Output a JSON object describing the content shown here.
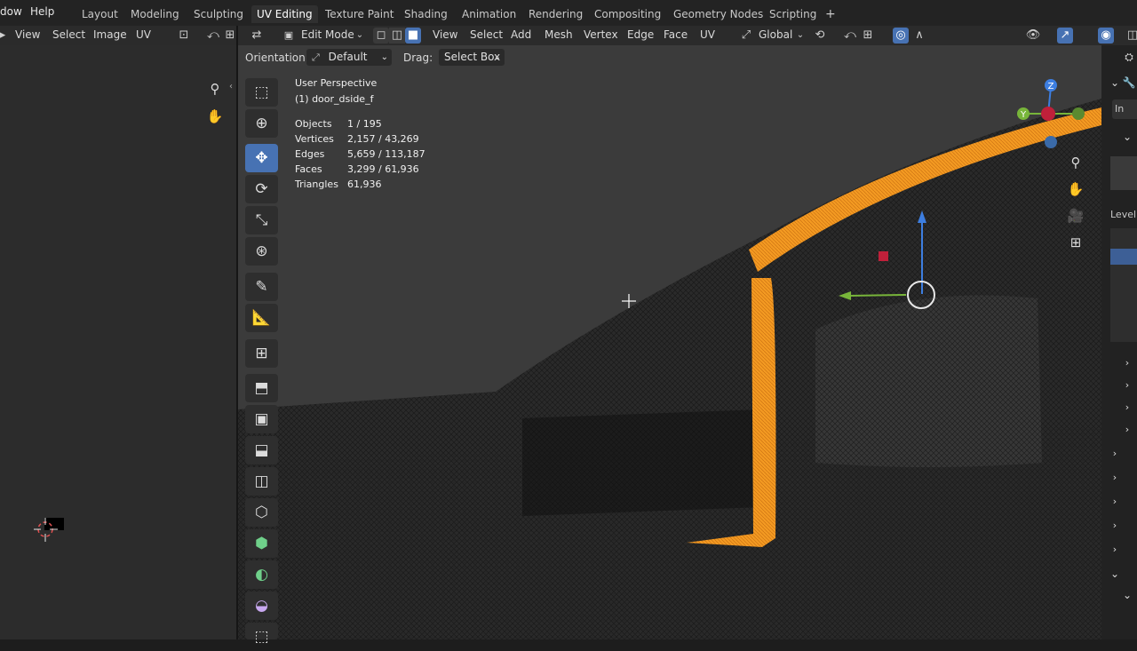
{
  "topbar": {
    "menus": [
      "dow",
      "Help"
    ],
    "workspaces": [
      {
        "label": "Layout"
      },
      {
        "label": "Modeling"
      },
      {
        "label": "Sculpting"
      },
      {
        "label": "UV Editing"
      },
      {
        "label": "Texture Paint"
      },
      {
        "label": "Shading"
      },
      {
        "label": "Animation"
      },
      {
        "label": "Rendering"
      },
      {
        "label": "Compositing"
      },
      {
        "label": "Geometry Nodes"
      },
      {
        "label": "Scripting"
      }
    ],
    "active_workspace": "UV Editing",
    "add_workspace": "+"
  },
  "uv_header": {
    "menus": [
      "View",
      "Select",
      "Image",
      "UV"
    ]
  },
  "viewport_header": {
    "mode": "Edit Mode",
    "menus": [
      "View",
      "Select",
      "Add",
      "Mesh",
      "Vertex",
      "Edge",
      "Face",
      "UV"
    ],
    "transform_orientation": "Global"
  },
  "tool_settings": {
    "orientation_label": "Orientation:",
    "orientation_value": "Default",
    "drag_label": "Drag:",
    "drag_value": "Select Box"
  },
  "overlay": {
    "view_name": "User Perspective",
    "object_name": "(1) door_dside_f",
    "stats": [
      {
        "label": "Objects",
        "value": "1 / 195"
      },
      {
        "label": "Vertices",
        "value": "2,157 / 43,269"
      },
      {
        "label": "Edges",
        "value": "5,659 / 113,187"
      },
      {
        "label": "Faces",
        "value": "3,299 / 61,936"
      },
      {
        "label": "Triangles",
        "value": "61,936"
      }
    ]
  },
  "gizmo": {
    "axis_z": "Z",
    "axis_y": "Y"
  },
  "right_panel": {
    "level_label": "Level",
    "import_label": "In"
  },
  "colors": {
    "accent": "#4772b3",
    "selection": "#f2921d",
    "axis_x": "#e0445a",
    "axis_y": "#78b53a",
    "axis_z": "#3d7ee0"
  }
}
